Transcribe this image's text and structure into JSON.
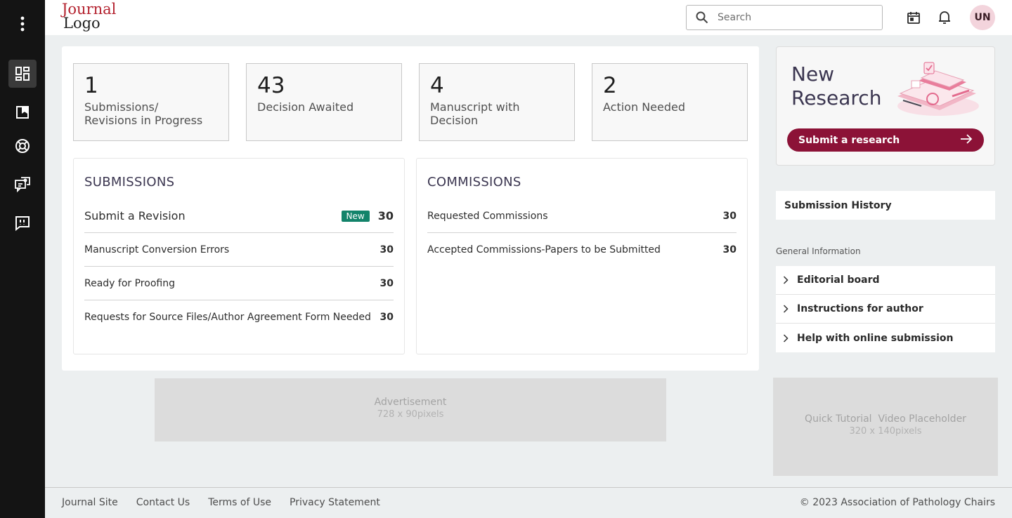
{
  "header": {
    "logo_line1": "Journal",
    "logo_line2": "Logo",
    "search_placeholder": "Search",
    "avatar_initials": "UN"
  },
  "sidebar": {
    "icons": [
      "more-vert-icon",
      "dashboard-icon",
      "bookmark-icon",
      "support-icon",
      "chat-person-icon",
      "feedback-icon"
    ],
    "active": "dashboard-icon"
  },
  "stats": [
    {
      "value": "1",
      "label_line1": "Submissions/",
      "label_line2": "Revisions in Progress"
    },
    {
      "value": "43",
      "label_line1": "Decision Awaited",
      "label_line2": ""
    },
    {
      "value": "4",
      "label_line1": "Manuscript with",
      "label_line2": "Decision"
    },
    {
      "value": "2",
      "label_line1": "Action Needed",
      "label_line2": ""
    }
  ],
  "submissions": {
    "title": "SUBMISSIONS",
    "rows": [
      {
        "label": "Submit a Revision",
        "badge": "New",
        "count": "30"
      },
      {
        "label": "Manuscript Conversion Errors",
        "count": "30"
      },
      {
        "label": "Ready for Proofing",
        "count": "30"
      },
      {
        "label": "Requests for Source Files/Author Agreement Form Needed",
        "count": "30"
      }
    ]
  },
  "commissions": {
    "title": "COMMISSIONS",
    "rows": [
      {
        "label": "Requested Commissions",
        "count": "30"
      },
      {
        "label": "Accepted Commissions-Papers to be Submitted",
        "count": "30"
      }
    ]
  },
  "ad": {
    "title": "Advertisement",
    "size": "728 x 90pixels"
  },
  "promo": {
    "title_line1": "New",
    "title_line2": "Research",
    "button": "Submit a research"
  },
  "history": {
    "label": "Submission History"
  },
  "general": {
    "title": "General Information",
    "items": [
      "Editorial board",
      "Instructions for author",
      "Help with online submission"
    ]
  },
  "video": {
    "title": "Quick Tutorial  Video Placeholder",
    "size": "320 x 140pixels"
  },
  "footer": {
    "links": [
      "Journal Site",
      "Contact Us",
      "Terms of Use",
      "Privacy Statement"
    ],
    "copyright": "© 2023 Association of Pathology Chairs"
  },
  "colors": {
    "brand_red": "#b3202d",
    "primary_button": "#8c1237",
    "badge_green": "#13836a",
    "rail": "#141414"
  }
}
